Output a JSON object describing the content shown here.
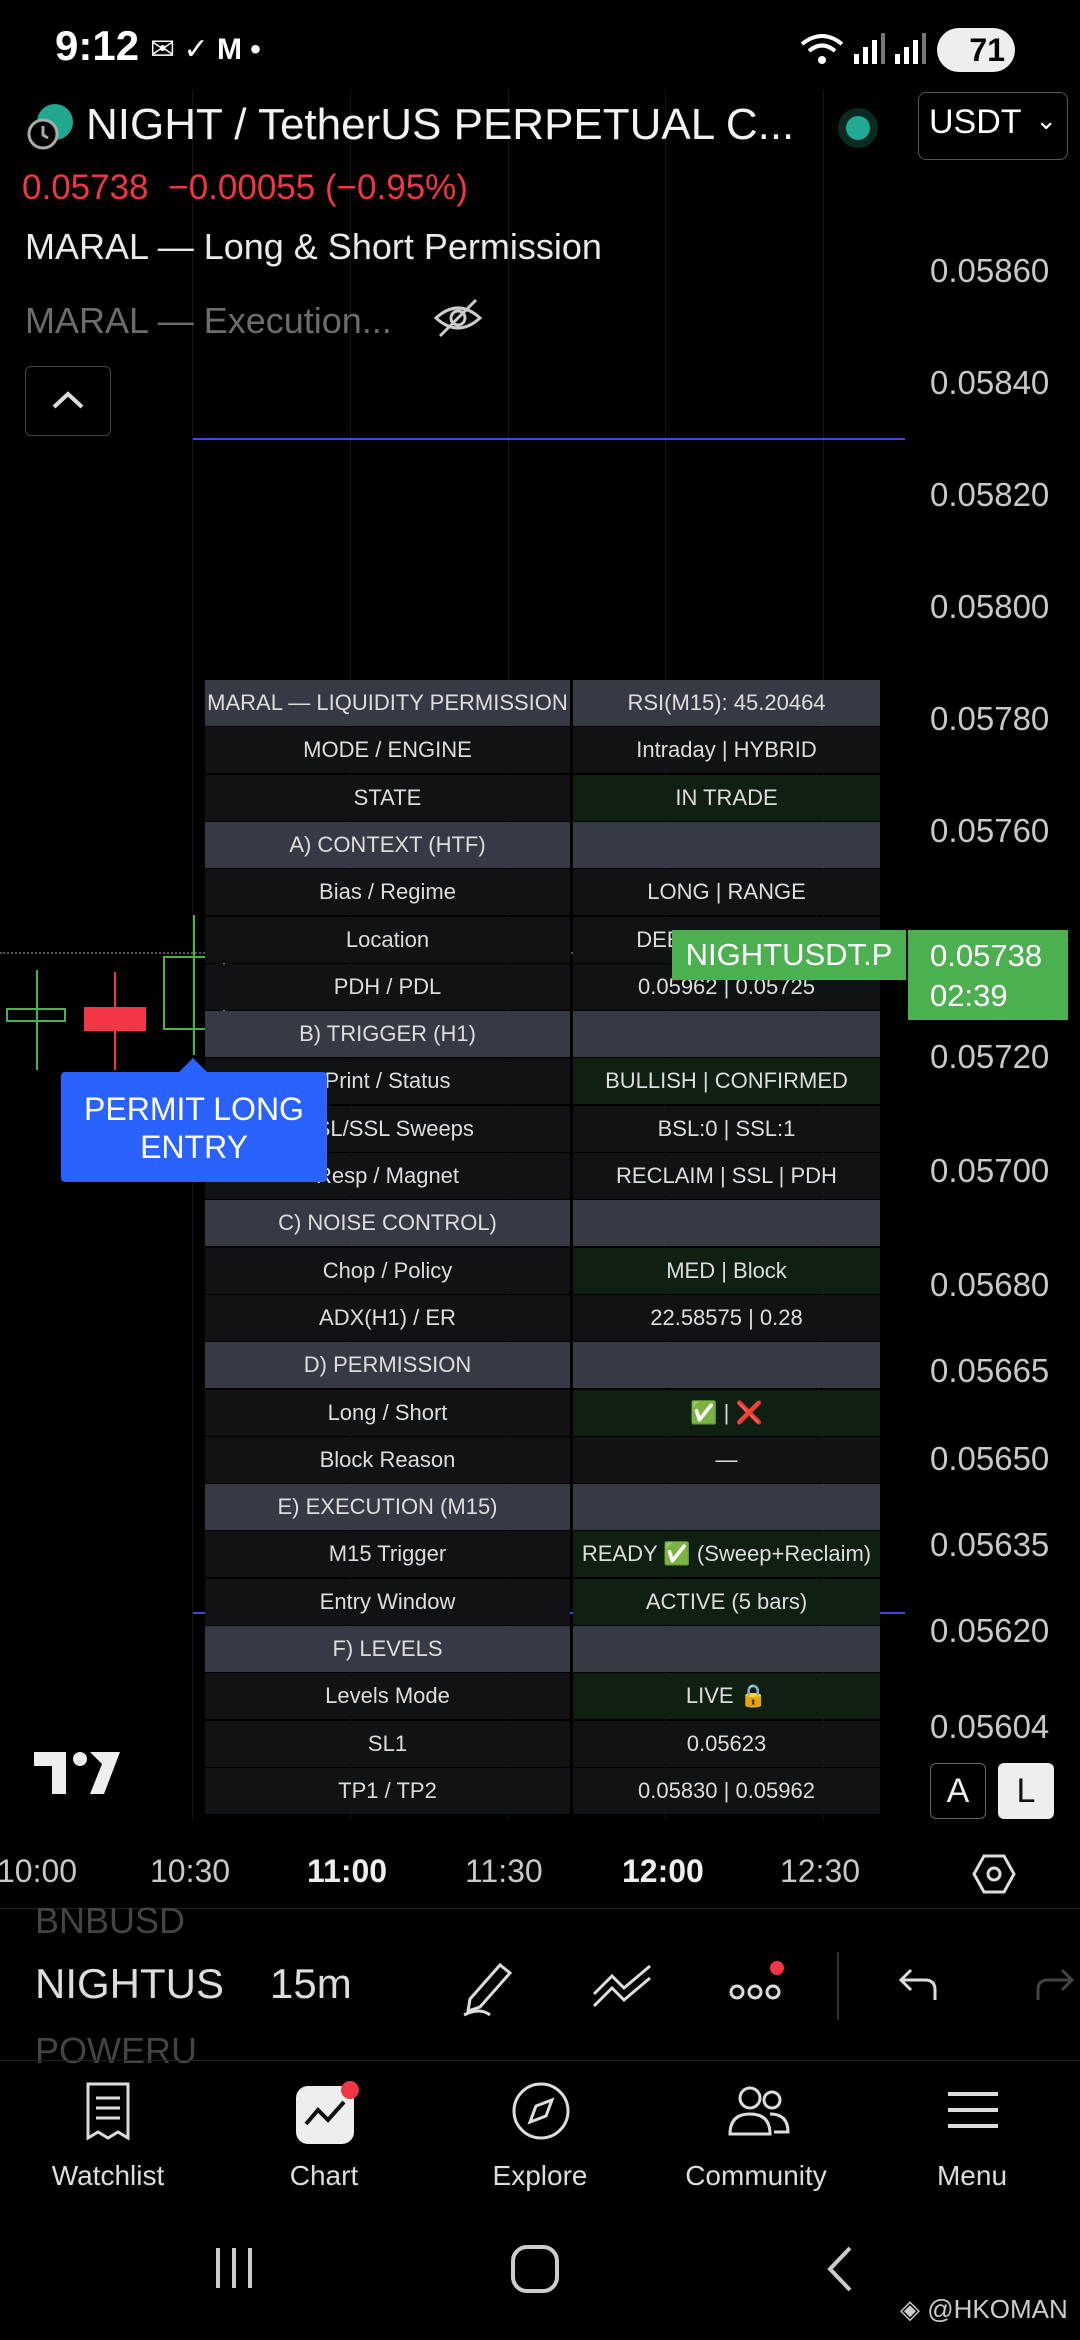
{
  "status_bar": {
    "time": "9:12",
    "battery": "71"
  },
  "header": {
    "symbol_title": "NIGHT / TetherUS PERPETUAL C...",
    "last_price": "0.05738",
    "change": "−0.00055 (−0.95%)",
    "currency": "USDT"
  },
  "studies": {
    "study1": "MARAL — Long & Short Permission",
    "study2": "MARAL — Execution..."
  },
  "price_scale": [
    "0.05860",
    "0.05840",
    "0.05820",
    "0.05800",
    "0.05780",
    "0.05760",
    "0.05720",
    "0.05700",
    "0.05680",
    "0.05665",
    "0.05650",
    "0.05635",
    "0.05620",
    "0.05604"
  ],
  "price_tag": {
    "symbol": "NIGHTUSDT.P",
    "price": "0.05738",
    "countdown": "02:39"
  },
  "permit_label": "PERMIT LONG ENTRY",
  "table": [
    {
      "l": "MARAL — LIQUIDITY PERMISSION",
      "r": "RSI(M15): 45.20464",
      "lbg": "head",
      "rbg": "head"
    },
    {
      "l": "MODE / ENGINE",
      "r": "Intraday | HYBRID",
      "lbg": "dark",
      "rbg": "dark"
    },
    {
      "l": "STATE",
      "r": "IN TRADE",
      "lbg": "dark",
      "rbg": "green"
    },
    {
      "l": "A) CONTEXT (HTF)",
      "r": "",
      "lbg": "head",
      "rbg": "head"
    },
    {
      "l": "Bias / Regime",
      "r": "LONG | RANGE",
      "lbg": "dark",
      "rbg": "dark"
    },
    {
      "l": "Location",
      "r": "DEEP DISCOUNT",
      "lbg": "dark",
      "rbg": "dark"
    },
    {
      "l": "PDH / PDL",
      "r": "0.05962 | 0.05725",
      "lbg": "dark",
      "rbg": "dark"
    },
    {
      "l": "B) TRIGGER (H1)",
      "r": "",
      "lbg": "head",
      "rbg": "head"
    },
    {
      "l": "Print / Status",
      "r": "BULLISH | CONFIRMED",
      "lbg": "dark",
      "rbg": "green"
    },
    {
      "l": "BSL/SSL Sweeps",
      "r": "BSL:0 | SSL:1",
      "lbg": "dark",
      "rbg": "dark"
    },
    {
      "l": "Resp / Magnet",
      "r": "RECLAIM | SSL | PDH",
      "lbg": "dark",
      "rbg": "dark"
    },
    {
      "l": "C) NOISE CONTROL)",
      "r": "",
      "lbg": "head",
      "rbg": "head"
    },
    {
      "l": "Chop / Policy",
      "r": "MED | Block",
      "lbg": "dark",
      "rbg": "green"
    },
    {
      "l": "ADX(H1) / ER",
      "r": "22.58575 | 0.28",
      "lbg": "dark",
      "rbg": "dark"
    },
    {
      "l": "D) PERMISSION",
      "r": "",
      "lbg": "head",
      "rbg": "head"
    },
    {
      "l": "Long / Short",
      "r": "✅ | ❌",
      "lbg": "dark",
      "rbg": "green"
    },
    {
      "l": "Block Reason",
      "r": "—",
      "lbg": "dark",
      "rbg": "dark"
    },
    {
      "l": "E) EXECUTION (M15)",
      "r": "",
      "lbg": "head",
      "rbg": "head"
    },
    {
      "l": "M15 Trigger",
      "r": "READY ✅ (Sweep+Reclaim)",
      "lbg": "dark",
      "rbg": "green"
    },
    {
      "l": "Entry Window",
      "r": "ACTIVE (5 bars)",
      "lbg": "dark",
      "rbg": "green"
    },
    {
      "l": "F) LEVELS",
      "r": "",
      "lbg": "head",
      "rbg": "head"
    },
    {
      "l": "Levels Mode",
      "r": "LIVE 🔒",
      "lbg": "dark",
      "rbg": "green"
    },
    {
      "l": "SL1",
      "r": "0.05623",
      "lbg": "dark",
      "rbg": "dark"
    },
    {
      "l": "TP1 / TP2",
      "r": "0.05830 | 0.05962",
      "lbg": "dark",
      "rbg": "dark"
    }
  ],
  "time_axis": [
    {
      "t": "10:00",
      "bold": false
    },
    {
      "t": "10:30",
      "bold": false
    },
    {
      "t": "11:00",
      "bold": true
    },
    {
      "t": "11:30",
      "bold": false
    },
    {
      "t": "12:00",
      "bold": true
    },
    {
      "t": "12:30",
      "bold": false
    }
  ],
  "scale_buttons": {
    "auto": "A",
    "log": "L"
  },
  "toolbar": {
    "symbol_prev": "BNBUSD",
    "symbol": "NIGHTUS",
    "symbol_next": "POWERU",
    "interval": "15m"
  },
  "bottom_nav": [
    {
      "label": "Watchlist",
      "icon": "watchlist-icon"
    },
    {
      "label": "Chart",
      "icon": "chart-icon"
    },
    {
      "label": "Explore",
      "icon": "compass-icon"
    },
    {
      "label": "Community",
      "icon": "community-icon"
    },
    {
      "label": "Menu",
      "icon": "menu-icon"
    }
  ],
  "watermark": "@HKOMAN",
  "colors": {
    "down": "#f23645",
    "up": "#4caf50",
    "accent_blue": "#2962ff",
    "table_head": "#363a45"
  }
}
